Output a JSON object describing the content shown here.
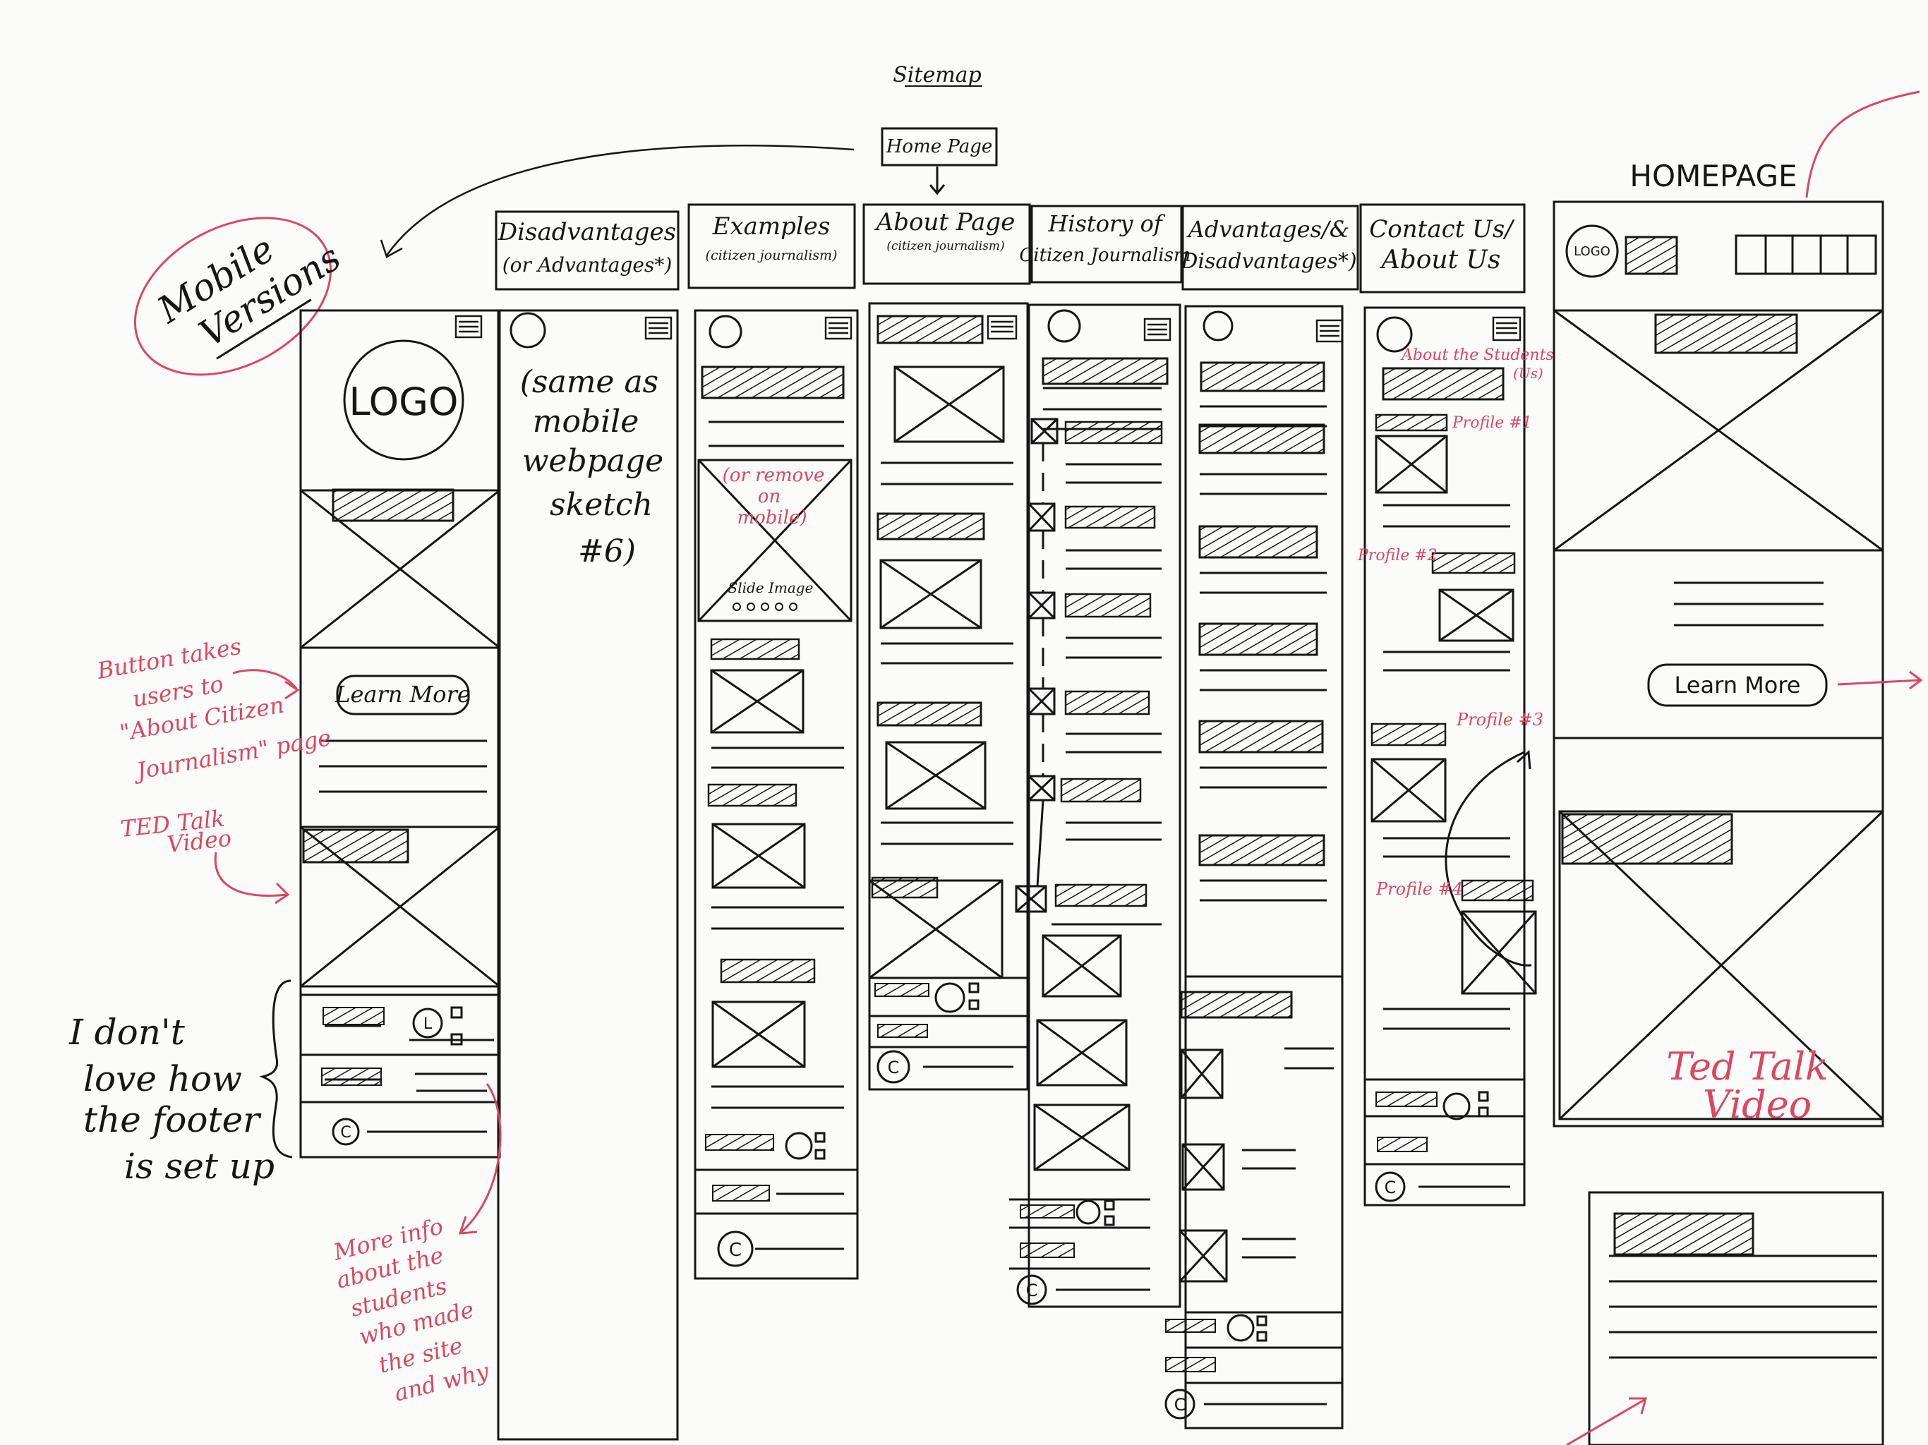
{
  "page_title": "Sitemap",
  "home_page": "Home Page",
  "columns": [
    {
      "title_line1": "Disadvantages",
      "title_line2": "(or Advantages*)"
    },
    {
      "title_line1": "Examples",
      "title_line2": "(citizen journalism)"
    },
    {
      "title_line1": "About Page",
      "title_line2": "(citizen journalism)"
    },
    {
      "title_line1": "History of",
      "title_line2": "Citizen Journalism"
    },
    {
      "title_line1": "Advantages/&",
      "title_line2": "Disadvantages*)"
    },
    {
      "title_line1": "Contact Us/",
      "title_line2": "About Us"
    }
  ],
  "desktop_heading": "HOMEPAGE",
  "logo_text": "LOGO",
  "desktop_logo_text": "LOGO",
  "learn_more": "Learn More",
  "desktop_learn_more": "Learn More",
  "mobile_versions": {
    "line1": "Mobile",
    "line2": "Versions"
  },
  "same_as_mobile": [
    "(same as",
    "mobile",
    "webpage",
    "sketch",
    "#6)"
  ],
  "or_remove": [
    "(or remove",
    "on",
    "mobile)"
  ],
  "slide_image": "Slide Image",
  "copyright": "C",
  "about_students": [
    "About the Students",
    "(Us)"
  ],
  "profiles": [
    "Profile #1",
    "Profile #2",
    "Profile #3",
    "Profile #4"
  ],
  "notes": {
    "button_note": [
      "Button takes",
      "users to",
      "\"About Citizen",
      "Journalism\" page"
    ],
    "ted_talk_note": [
      "TED Talk",
      "Video"
    ],
    "footer_note": [
      "I don't",
      "love how",
      "the footer",
      "is set up"
    ],
    "more_info_note": [
      "More info",
      "about the",
      "students",
      "who made",
      "the site",
      "and why"
    ],
    "ted_talk_desktop": [
      "Ted Talk",
      "Video"
    ]
  },
  "colors": {
    "ink": "#161616",
    "red_annotation": "#d9485f",
    "paper": "#fbfbfa"
  }
}
